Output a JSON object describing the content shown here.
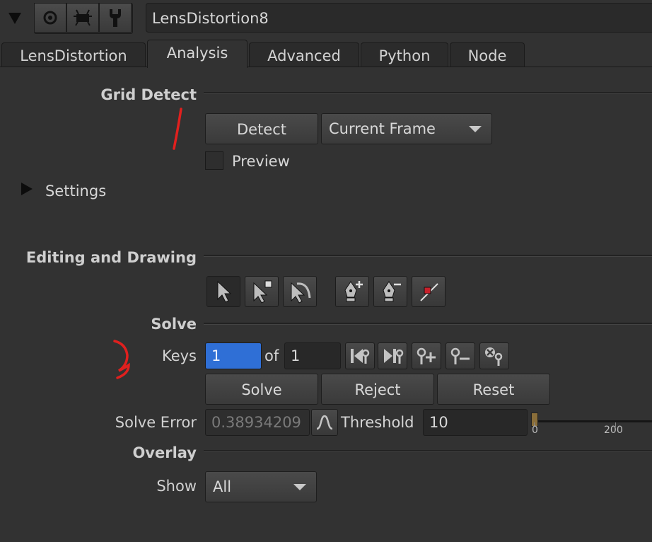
{
  "node_name": "LensDistortion8",
  "tabs": [
    {
      "label": "LensDistortion",
      "active": false
    },
    {
      "label": "Analysis",
      "active": true
    },
    {
      "label": "Advanced",
      "active": false
    },
    {
      "label": "Python",
      "active": false
    },
    {
      "label": "Node",
      "active": false
    }
  ],
  "grid_detect": {
    "heading": "Grid Detect",
    "detect_label": "Detect",
    "frame_option": "Current Frame",
    "preview_label": "Preview",
    "preview_checked": false
  },
  "settings": {
    "label": "Settings",
    "expanded": false
  },
  "editing": {
    "heading": "Editing and Drawing"
  },
  "solve": {
    "heading": "Solve",
    "keys_label": "Keys",
    "key_current": "1",
    "of_label": "of",
    "key_total": "1",
    "solve_label": "Solve",
    "reject_label": "Reject",
    "reset_label": "Reset",
    "error_label": "Solve Error",
    "error_value": "0.38934209",
    "threshold_label": "Threshold",
    "threshold_value": "10",
    "slider_tick_0": "0",
    "slider_tick_200": "200"
  },
  "overlay": {
    "heading": "Overlay",
    "show_label": "Show",
    "show_value": "All"
  },
  "colors": {
    "background": "#323232",
    "key_field_highlight": "#2f6fd6",
    "annotation": "#e0201e"
  }
}
